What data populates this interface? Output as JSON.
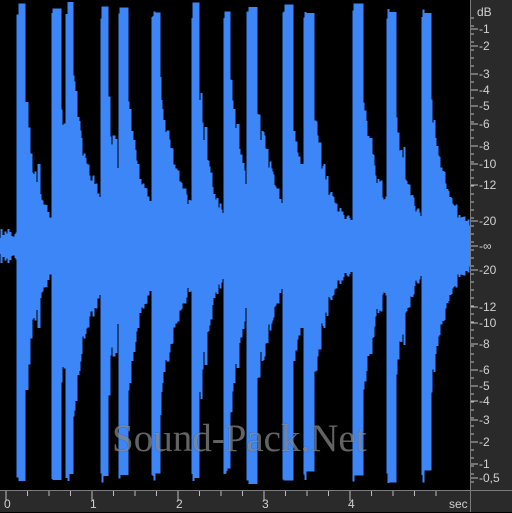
{
  "editor": {
    "waveform": {
      "color": "#3d86f7",
      "background": "#000000",
      "duration_seconds": 5.15,
      "onsets_seconds": [
        0.15,
        0.55,
        0.72,
        1.12,
        1.33,
        1.72,
        2.18,
        2.55,
        2.82,
        3.24,
        3.48,
        4.05,
        4.45,
        4.85
      ],
      "envelope": "percussive transients with strong attacks and quick decays"
    },
    "db_scale": {
      "unit": "dB",
      "labels": [
        "-1",
        "-2",
        "-3",
        "-4",
        "-5",
        "-6",
        "-8",
        "-10",
        "-12",
        "-20",
        "-∞",
        "-20",
        "-12",
        "-10",
        "-8",
        "-6",
        "-5",
        "-4",
        "-3",
        "-2",
        "-1",
        "-0,5"
      ]
    },
    "time_scale": {
      "unit": "sec",
      "labels": [
        "0",
        "1",
        "2",
        "3",
        "4"
      ]
    },
    "watermark": "Sound-Pack.Net",
    "colors": {
      "ruler_background": "#2a2a2a",
      "ruler_text": "#d0d0d0",
      "ruler_tick": "#bcbcbc",
      "divider": "#7b7b7b"
    }
  }
}
